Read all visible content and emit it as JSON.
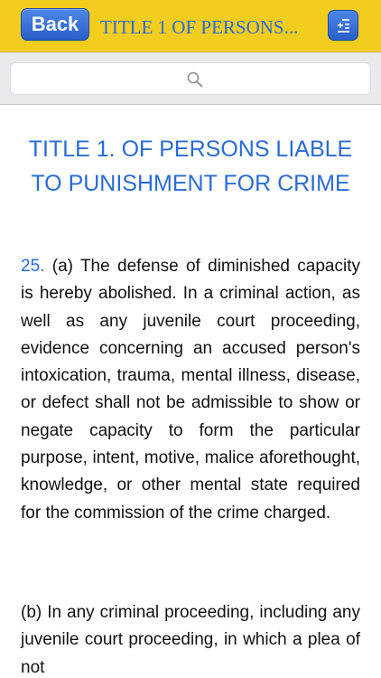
{
  "navbar": {
    "back_label": "Back",
    "title": "TITLE 1 OF PERSONS...",
    "background_color": "#f3cd1e",
    "button_color": "#2a5fc8",
    "toc_icon": "list-toc-icon"
  },
  "search": {
    "placeholder": "",
    "icon": "search-icon"
  },
  "content": {
    "heading": "TITLE 1. OF PERSONS LIABLE TO PUNISHMENT FOR CRIME",
    "section_number": "25.",
    "paragraph_a": " (a) The defense of diminished capacity is hereby abolished. In a criminal action, as well as any juvenile court proceeding, evidence concerning an accused person's intoxication, trauma, mental illness, disease, or defect shall not be admissible to show or negate capacity to form the particular purpose, intent, motive, malice aforethought, knowledge, or other mental state required for the commission of the crime charged.",
    "paragraph_b": "(b) In any criminal proceeding, including any juvenile court proceeding, in which a plea of not",
    "accent_color": "#2a6bd6"
  }
}
